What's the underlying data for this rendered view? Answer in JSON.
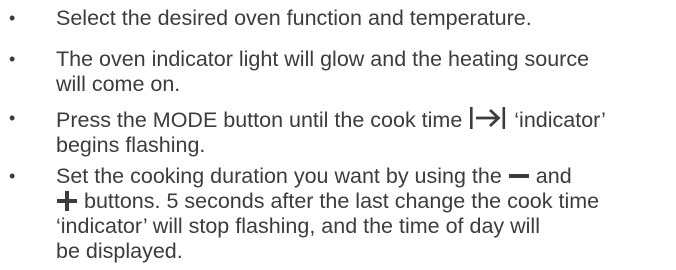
{
  "instructions": {
    "bullet": "•",
    "items": [
      {
        "lines": [
          "Select the desired oven function and temperature."
        ]
      },
      {
        "lines": [
          "The oven indicator light will glow and the heating source",
          "will come on."
        ]
      },
      {
        "line1_before": "Press the MODE button until the cook time",
        "line1_after": "‘indicator’",
        "line2": "begins flashing.",
        "icon": "cook-time-arrow-icon"
      },
      {
        "line1_before": "Set the cooking duration you want by using the",
        "line1_after": "and",
        "line2_after": "buttons. 5 seconds after the last change the cook time",
        "line3": "‘indicator’ will stop flashing, and the time of day will",
        "line4": "be displayed.",
        "icons": [
          "minus-icon",
          "plus-icon"
        ]
      }
    ]
  }
}
